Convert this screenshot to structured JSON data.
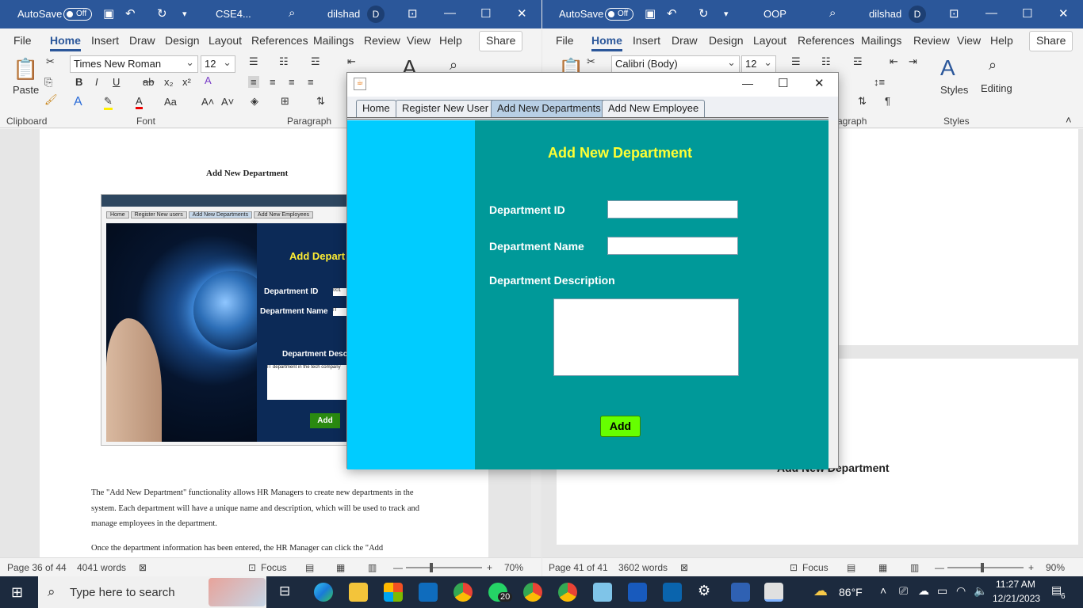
{
  "left_word": {
    "autosave_label": "AutoSave",
    "autosave_state": "Off",
    "doc_title": "CSE4...",
    "user_name": "dilshad",
    "avatar_letter": "D",
    "menu": [
      "File",
      "Home",
      "Insert",
      "Draw",
      "Design",
      "Layout",
      "References",
      "Mailings",
      "Review",
      "View",
      "Help"
    ],
    "share_label": "Share",
    "font_name": "Times New Roman",
    "font_size": "12",
    "paste_label": "Paste",
    "groups": {
      "clipboard": "Clipboard",
      "font": "Font",
      "paragraph": "Paragraph"
    },
    "doc_heading": "Add New Department",
    "embedded": {
      "tabs": [
        "Home",
        "Register New users",
        "Add New Departments",
        "Add New Employees"
      ],
      "title": "Add Depart",
      "dept_id_label": "Department ID",
      "dept_id_value": "001",
      "dept_name_label": "Department Name",
      "dept_name_value": "IT",
      "desc_label": "Department Desc",
      "desc_value": "IT department in the tech company",
      "add_label": "Add"
    },
    "paragraph1": "The \"Add New Department\" functionality allows HR Managers to create new departments in the system. Each department will have a unique name and description, which will be used to track and manage employees in the department.",
    "paragraph2": "Once the department information has been entered, the HR Manager can click the \"Add",
    "status_page": "Page 36 of 44",
    "status_words": "4041 words",
    "focus": "Focus",
    "zoom": "70%"
  },
  "right_word": {
    "autosave_label": "AutoSave",
    "autosave_state": "Off",
    "doc_title": "OOP",
    "user_name": "dilshad",
    "avatar_letter": "D",
    "menu": [
      "File",
      "Home",
      "Insert",
      "Draw",
      "Design",
      "Layout",
      "References",
      "Mailings",
      "Review",
      "View",
      "Help"
    ],
    "share_label": "Share",
    "font_name": "Calibri (Body)",
    "font_size": "12",
    "groups": {
      "paragraph": "agraph",
      "styles": "Styles"
    },
    "styles_label": "Styles",
    "editing_label": "Editing",
    "doc_heading": "Add New Department",
    "status_page": "Page 41 of 41",
    "status_words": "3602 words",
    "focus": "Focus",
    "zoom": "90%"
  },
  "app": {
    "tabs": [
      "Home",
      "Register New User",
      "Add New Departments",
      "Add New Employee"
    ],
    "selected_tab": 2,
    "heading": "Add New Department",
    "dept_id_label": "Department ID",
    "dept_name_label": "Department Name",
    "dept_desc_label": "Department Description",
    "dept_id_value": "",
    "dept_name_value": "",
    "dept_desc_value": "",
    "add_label": "Add",
    "colors": {
      "left_panel": "#00ccff",
      "main_panel": "#009999",
      "heading": "#ffff33",
      "add_button": "#66ff00"
    }
  },
  "taskbar": {
    "search_placeholder": "Type here to search",
    "whatsapp_badge": "20",
    "weather": "86°F",
    "time": "11:27 AM",
    "date": "12/21/2023",
    "notification_count": "6"
  }
}
